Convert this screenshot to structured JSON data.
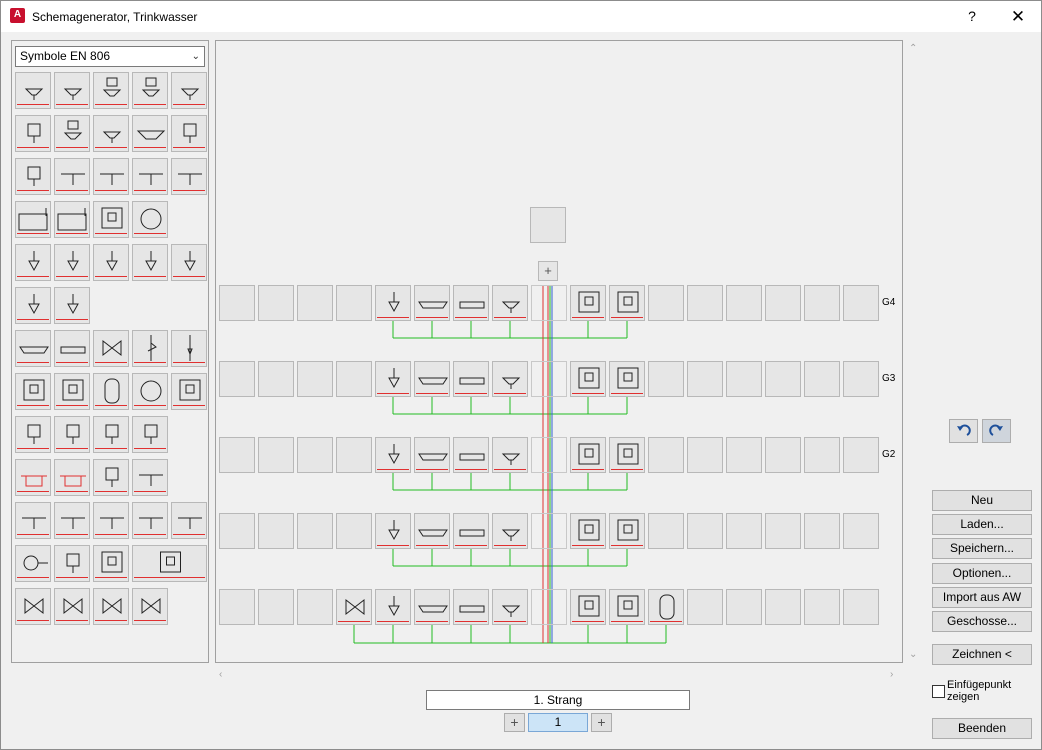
{
  "window": {
    "title": "Schemagenerator, Trinkwasser",
    "help_label": "?",
    "close_label": "✕",
    "app_icon_letter": "A"
  },
  "symbols": {
    "library_selected": "Symbole EN 806"
  },
  "canvas": {
    "floors": [
      {
        "label": "G4"
      },
      {
        "label": "G3"
      },
      {
        "label": "G2"
      },
      {
        "label": ""
      },
      {
        "label": ""
      }
    ],
    "add_label": "+"
  },
  "right_panel": {
    "undo_icon": "undo-icon",
    "redo_icon": "redo-icon",
    "buttons": {
      "neu": "Neu",
      "laden": "Laden...",
      "speichern": "Speichern...",
      "optionen": "Optionen...",
      "import": "Import aus AW",
      "geschosse": "Geschosse...",
      "zeichnen": "Zeichnen <",
      "beenden": "Beenden"
    },
    "checkbox_label": "Einfügepunkt zeigen"
  },
  "strang": {
    "name": "1. Strang",
    "page": "1",
    "prev_label": "+",
    "next_label": "+"
  },
  "colors": {
    "pipe_green": "#22bb22",
    "riser_red": "#e03030",
    "riser_blue": "#3060d0",
    "accent_red": "#e03030"
  }
}
